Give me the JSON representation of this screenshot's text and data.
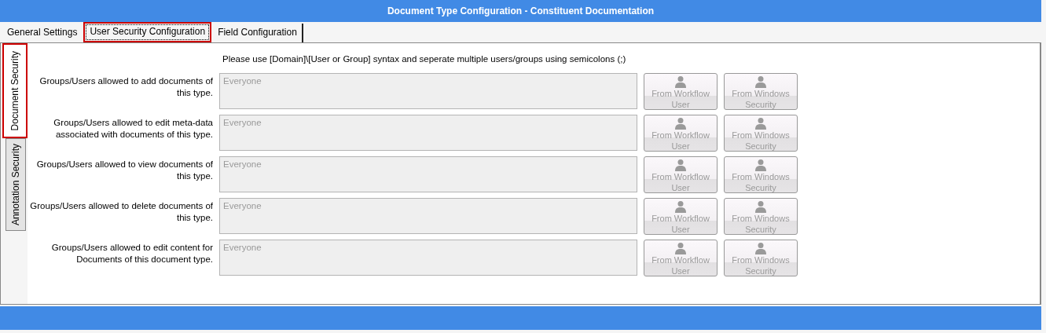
{
  "window": {
    "title": "Document Type Configuration - Constituent Documentation"
  },
  "tabs": [
    {
      "label": "General Settings",
      "selected": false
    },
    {
      "label": "User Security Configuration",
      "selected": true
    },
    {
      "label": "Field Configuration",
      "selected": false
    }
  ],
  "side_tabs": [
    {
      "label": "Document Security",
      "selected": true
    },
    {
      "label": "Annotation Security",
      "selected": false
    }
  ],
  "instruction": "Please use [Domain]\\[User or Group] syntax and seperate multiple users/groups using semicolons (;)",
  "rows": [
    {
      "label": "Groups/Users allowed to add documents of this type.",
      "value": "Everyone",
      "buttons": [
        {
          "label": "From Workflow User",
          "disabled": true
        },
        {
          "label": "From Windows Security",
          "disabled": true
        }
      ]
    },
    {
      "label": "Groups/Users allowed to edit meta-data associated with documents of this type.",
      "value": "Everyone",
      "buttons": [
        {
          "label": "From Workflow User",
          "disabled": true
        },
        {
          "label": "From Windows Security",
          "disabled": true
        }
      ]
    },
    {
      "label": "Groups/Users allowed to view documents of this type.",
      "value": "Everyone",
      "buttons": [
        {
          "label": "From Workflow User",
          "disabled": true
        },
        {
          "label": "From Windows Security",
          "disabled": true
        }
      ]
    },
    {
      "label": "Groups/Users allowed to delete documents of this type.",
      "value": "Everyone",
      "buttons": [
        {
          "label": "From Workflow User",
          "disabled": true
        },
        {
          "label": "From Windows Security",
          "disabled": true
        }
      ]
    },
    {
      "label": "Groups/Users allowed to edit content for Documents of this document type.",
      "value": "Everyone",
      "buttons": [
        {
          "label": "From Workflow User",
          "disabled": true
        },
        {
          "label": "From Windows Security",
          "disabled": true
        }
      ]
    }
  ]
}
